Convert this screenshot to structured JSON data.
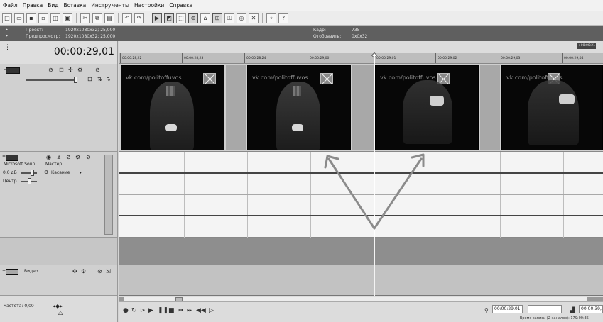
{
  "menu": [
    "Файл",
    "Правка",
    "Вид",
    "Вставка",
    "Инструменты",
    "Настройки",
    "Справка"
  ],
  "toolbar_icons": [
    "new-icon",
    "open-icon",
    "save-icon",
    "save-as-icon",
    "properties-icon",
    "cut-icon",
    "copy-icon",
    "paste-icon",
    "undo-icon",
    "redo-icon",
    "normal-edit-tool-icon",
    "envelope-tool-icon",
    "selection-tool-icon",
    "zoom-tool-icon",
    "snap-icon",
    "auto-ripple-icon",
    "lock-envelopes-icon",
    "ignore-grouping-icon",
    "cursor-icon",
    "help-icon"
  ],
  "info": {
    "project_label": "Проект:",
    "project_value": "1920x1080x32; 25,000",
    "preview_label": "Предпросмотр:",
    "preview_value": "1920x1080x32; 25,000",
    "frame_label": "Кадр:",
    "frame_value": "735",
    "display_label": "Отобразить:",
    "display_value": "0x0x32"
  },
  "timecode": "00:00:29,01",
  "ruler": {
    "tag": "+00:00:21",
    "ticks": [
      "00:00:28,22",
      "00:00:28,23",
      "00:00:28,24",
      "00:00:29,00",
      "00:00:29,01",
      "00:00:29,02",
      "00:00:29,03",
      "00:00:29,04"
    ]
  },
  "watermark": "vk.com/politoffuvos",
  "audio_track": {
    "name": "Microsoft Soun...",
    "master": "Мастер",
    "volume": "0,0 дБ",
    "touch": "Касание",
    "pan": "Центр"
  },
  "bus_track": {
    "name": "Видео"
  },
  "bottom": {
    "rate_label": "Частота: 0,00",
    "timecode": "00:00:29,01",
    "timecode_end": "00:00:39,0",
    "status": "Время записи (2 каналов): 179:00:35"
  },
  "colors": {
    "arrow": "#8b8b8b",
    "clip": "#070707",
    "info_bar": "#5f5f5f"
  }
}
